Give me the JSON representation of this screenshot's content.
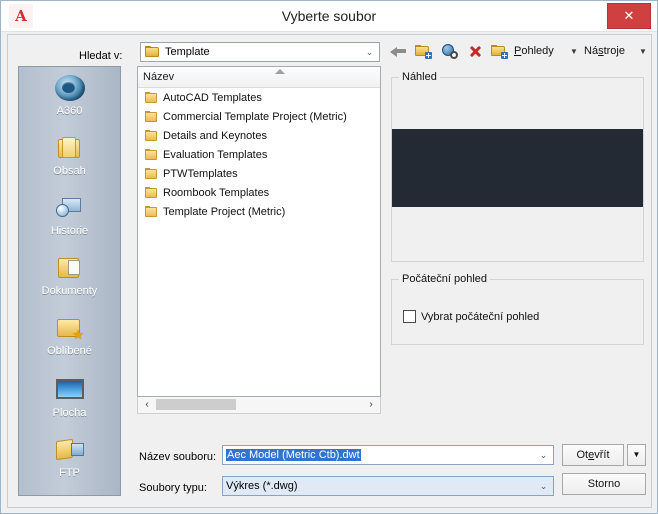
{
  "window": {
    "title": "Vyberte soubor",
    "app_icon": "autocad-a-icon",
    "app_icon_letter": "A",
    "close_label": "✕",
    "close_color": "#cf4040"
  },
  "lookin": {
    "label": "Hledat v:",
    "value": "Template",
    "arrow": "⌄"
  },
  "toolbar": {
    "items": [
      {
        "name": "back-button",
        "icon": "back-arrow-icon",
        "label": ""
      },
      {
        "name": "up-one-level-button",
        "icon": "folder-up-icon",
        "label": ""
      },
      {
        "name": "search-web-button",
        "icon": "globe-search-icon",
        "label": ""
      },
      {
        "name": "delete-button",
        "icon": "red-x-delete-icon",
        "label": ""
      },
      {
        "name": "create-new-folder-button",
        "icon": "new-folder-icon",
        "label": ""
      }
    ],
    "views_label_pre": "P",
    "views_label_post": "ohledy",
    "tools_label_pre": "Ná",
    "tools_label_mid": "s",
    "tools_label_post": "troje",
    "caret": "▼"
  },
  "places": {
    "items": [
      {
        "label": "A360",
        "icon": "a360-cloud-icon"
      },
      {
        "label": "Obsah",
        "icon": "content-folder-icon"
      },
      {
        "label": "Historie",
        "icon": "history-clock-icon"
      },
      {
        "label": "Dokumenty",
        "icon": "documents-folder-icon"
      },
      {
        "label": "Oblíbené",
        "icon": "favorites-star-folder-icon"
      },
      {
        "label": "Plocha",
        "icon": "desktop-monitor-icon"
      },
      {
        "label": "FTP",
        "icon": "ftp-folder-icon"
      }
    ]
  },
  "filelist": {
    "column_header": "Název",
    "sort_direction": "ascending",
    "rows": [
      {
        "name": "AutoCAD Templates",
        "icon": "folder-icon"
      },
      {
        "name": "Commercial Template Project (Metric)",
        "icon": "folder-icon"
      },
      {
        "name": "Details and Keynotes",
        "icon": "folder-icon"
      },
      {
        "name": "Evaluation Templates",
        "icon": "folder-icon"
      },
      {
        "name": "PTWTemplates",
        "icon": "folder-icon"
      },
      {
        "name": "Roombook Templates",
        "icon": "folder-icon"
      },
      {
        "name": "Template Project (Metric)",
        "icon": "folder-icon"
      }
    ],
    "scroll_left": "‹",
    "scroll_right": "›"
  },
  "preview": {
    "legend": "Náhled",
    "image_color": "#242a34"
  },
  "startview": {
    "legend": "Počáteční pohled",
    "checkbox_label": "Vybrat počáteční pohled",
    "checked": false
  },
  "fields": {
    "filename_label": "Název souboru:",
    "filename_value": "Aec Model (Metric Ctb).dwt",
    "filename_selected": true,
    "filetype_label": "Soubory typu:",
    "filetype_value": "Výkres (*.dwg)",
    "arrow": "⌄"
  },
  "buttons": {
    "open_pre": "Ot",
    "open_mid": "e",
    "open_post": "vřít",
    "open_more": "▼",
    "cancel": "Storno"
  }
}
